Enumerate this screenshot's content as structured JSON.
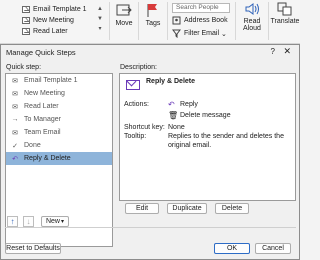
{
  "ribbon": {
    "quick_steps": [
      "Email Template 1",
      "New Meeting",
      "Read Later"
    ],
    "move_label": "Move",
    "tags_label": "Tags",
    "search_placeholder": "Search People",
    "address_book": "Address Book",
    "filter_email": "Filter Email",
    "read_aloud": [
      "Read",
      "Aloud"
    ],
    "translate": "Translate"
  },
  "dialog": {
    "title": "Manage Quick Steps",
    "help_glyph": "?",
    "close_glyph": "✕",
    "quick_step_label": "Quick step:",
    "description_label": "Description:",
    "items": [
      {
        "label": "Email Template 1",
        "icon": "envelope-icon"
      },
      {
        "label": "New Meeting",
        "icon": "envelope-icon"
      },
      {
        "label": "Read Later",
        "icon": "envelope-icon"
      },
      {
        "label": "To Manager",
        "icon": "forward-arrow-icon"
      },
      {
        "label": "Team Email",
        "icon": "envelope-icon"
      },
      {
        "label": "Done",
        "icon": "check-icon"
      },
      {
        "label": "Reply & Delete",
        "icon": "reply-icon"
      }
    ],
    "selected_index": 6,
    "description": {
      "title": "Reply & Delete",
      "actions_label": "Actions:",
      "actions": [
        "Reply",
        "Delete message"
      ],
      "shortcut_label": "Shortcut key:",
      "shortcut_value": "None",
      "tooltip_label": "Tooltip:",
      "tooltip_value": [
        "Replies to the sender and deletes the",
        "original email."
      ]
    },
    "buttons": {
      "edit": "Edit",
      "duplicate": "Duplicate",
      "delete": "Delete",
      "new": "New",
      "reset": "Reset to Defaults",
      "ok": "OK",
      "cancel": "Cancel"
    },
    "accent_color": "#8eb4da"
  }
}
